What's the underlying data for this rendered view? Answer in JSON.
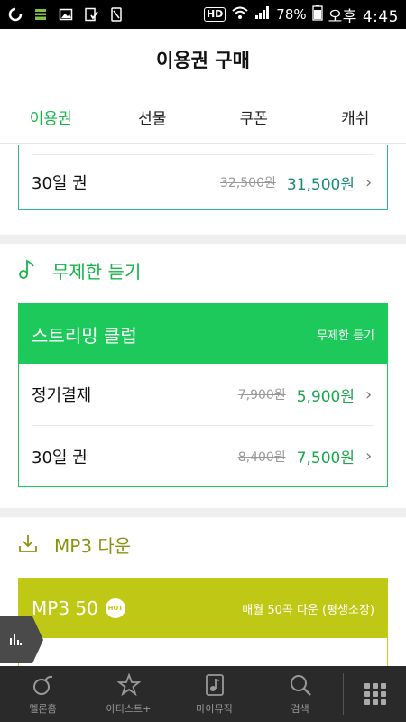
{
  "status_bar": {
    "battery": "78%",
    "time": "오후 4:45",
    "hd": "HD"
  },
  "header": {
    "title": "이용권 구매"
  },
  "tabs": [
    {
      "label": "이용권",
      "active": true
    },
    {
      "label": "선물",
      "active": false
    },
    {
      "label": "쿠폰",
      "active": false
    },
    {
      "label": "캐쉬",
      "active": false
    }
  ],
  "top_card": {
    "rows": [
      {
        "label": "30일 권",
        "old_price": "32,500원",
        "price": "31,500원"
      }
    ]
  },
  "unlimited_section": {
    "title": "무제한 듣기",
    "card_title": "스트리밍 클럽",
    "card_sub": "무제한 듣기",
    "rows": [
      {
        "label": "정기결제",
        "old_price": "7,900원",
        "price": "5,900원"
      },
      {
        "label": "30일 권",
        "old_price": "8,400원",
        "price": "7,500원"
      }
    ]
  },
  "mp3_section": {
    "title": "MP3 다운",
    "card_title": "MP3 50",
    "badge": "HOT",
    "card_sub": "매월 50곡 다운 (평생소장)"
  },
  "bottom_nav": [
    {
      "label": "멜론홈",
      "icon": "melon-icon"
    },
    {
      "label": "아티스트+",
      "icon": "star-icon"
    },
    {
      "label": "마이뮤직",
      "icon": "music-note-icon"
    },
    {
      "label": "검색",
      "icon": "search-icon"
    }
  ],
  "colors": {
    "green": "#1ec95b",
    "lime": "#bfc815",
    "teal": "#2dbb8a"
  }
}
